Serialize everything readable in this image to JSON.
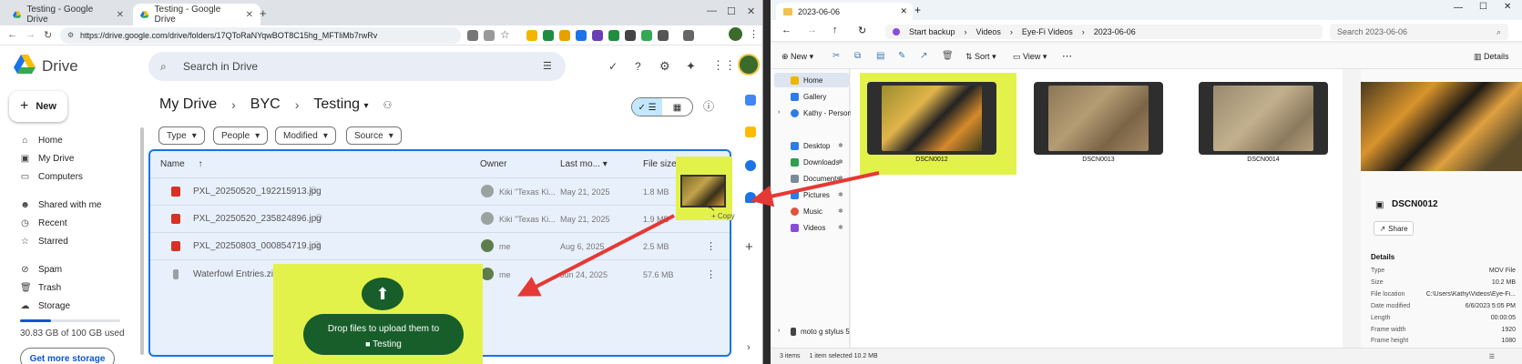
{
  "colors": {
    "highlight": "#e3f24a",
    "drive_blue": "#1a73e8",
    "upload_green": "#185e2a",
    "arrow_red": "#e53935"
  },
  "chrome": {
    "tabs": [
      {
        "title": "Testing - Google Drive",
        "active": false
      },
      {
        "title": "Testing - Google Drive",
        "active": true
      }
    ],
    "url": "https://drive.google.com/drive/folders/17QToRaNYqwBOT8C15hg_MFTliMb7rwRv"
  },
  "drive": {
    "brand": "Drive",
    "search_placeholder": "Search in Drive",
    "new_label": "New",
    "sidebar": [
      {
        "label": "Home",
        "icon": "home-icon"
      },
      {
        "label": "My Drive",
        "icon": "my-drive-icon"
      },
      {
        "label": "Computers",
        "icon": "computers-icon"
      },
      {
        "label": "Shared with me",
        "icon": "shared-icon"
      },
      {
        "label": "Recent",
        "icon": "clock-icon"
      },
      {
        "label": "Starred",
        "icon": "star-icon"
      },
      {
        "label": "Spam",
        "icon": "spam-icon"
      },
      {
        "label": "Trash",
        "icon": "trash-icon"
      },
      {
        "label": "Storage",
        "icon": "cloud-icon"
      }
    ],
    "storage_text": "30.83 GB of 100 GB used",
    "storage_fraction": 0.31,
    "get_storage": "Get more storage",
    "breadcrumb": [
      "My Drive",
      "BYC",
      "Testing"
    ],
    "filters": [
      "Type",
      "People",
      "Modified",
      "Source"
    ],
    "columns": {
      "name": "Name",
      "owner": "Owner",
      "modified": "Last mo...",
      "size": "File size"
    },
    "files": [
      {
        "name": "PXL_20250520_192215913.jpg",
        "owner": "Kiki \"Texas Ki...",
        "modified": "May 21, 2025",
        "size": "1.8 MB"
      },
      {
        "name": "PXL_20250520_235824896.jpg",
        "owner": "Kiki \"Texas Ki...",
        "modified": "May 21, 2025",
        "size": "1.9 MB"
      },
      {
        "name": "PXL_20250803_000854719.jpg",
        "owner": "me",
        "modified": "Aug 6, 2025",
        "size": "2.5 MB"
      },
      {
        "name": "Waterfowl Entries.zip",
        "owner": "me",
        "modified": "Jun 24, 2025",
        "size": "57.6 MB"
      }
    ],
    "drop_text": "Drop files to upload them to",
    "drop_folder": "Testing",
    "copy_badge": "+ Copy"
  },
  "explorer": {
    "tab_title": "2023-06-06",
    "breadcrumb": [
      "Start backup",
      "Videos",
      "Eye-Fi Videos",
      "2023-06-06"
    ],
    "search_placeholder": "Search 2023-06-06",
    "commands": {
      "new": "New",
      "sort": "Sort",
      "view": "View",
      "details": "Details"
    },
    "nav": [
      {
        "label": "Home",
        "color": "#f1b400"
      },
      {
        "label": "Gallery",
        "color": "#2b7de9"
      },
      {
        "label": "Kathy - Persona",
        "color": "#2b7de9"
      },
      {
        "label": "Desktop",
        "color": "#2b7de9"
      },
      {
        "label": "Downloads",
        "color": "#2e9e4f"
      },
      {
        "label": "Documents",
        "color": "#7a8a99"
      },
      {
        "label": "Pictures",
        "color": "#2b7de9"
      },
      {
        "label": "Music",
        "color": "#e0533c"
      },
      {
        "label": "Videos",
        "color": "#8b4bd8"
      },
      {
        "label": "moto g stylus 5",
        "color": "#444444"
      }
    ],
    "files": [
      "DSCN0012",
      "DSCN0013",
      "DSCN0014"
    ],
    "details": {
      "title": "DSCN0012",
      "share": "Share",
      "section": "Details",
      "rows": [
        {
          "k": "Type",
          "v": "MOV File"
        },
        {
          "k": "Size",
          "v": "10.2 MB"
        },
        {
          "k": "File location",
          "v": "C:\\Users\\Kathy\\Videos\\Eye-Fi..."
        },
        {
          "k": "Date modified",
          "v": "6/6/2023 5:05 PM"
        },
        {
          "k": "Length",
          "v": "00:00:05"
        },
        {
          "k": "Frame width",
          "v": "1920"
        },
        {
          "k": "Frame height",
          "v": "1080"
        }
      ]
    },
    "status": {
      "items": "3 items",
      "selected": "1 item selected  10.2 MB"
    }
  }
}
